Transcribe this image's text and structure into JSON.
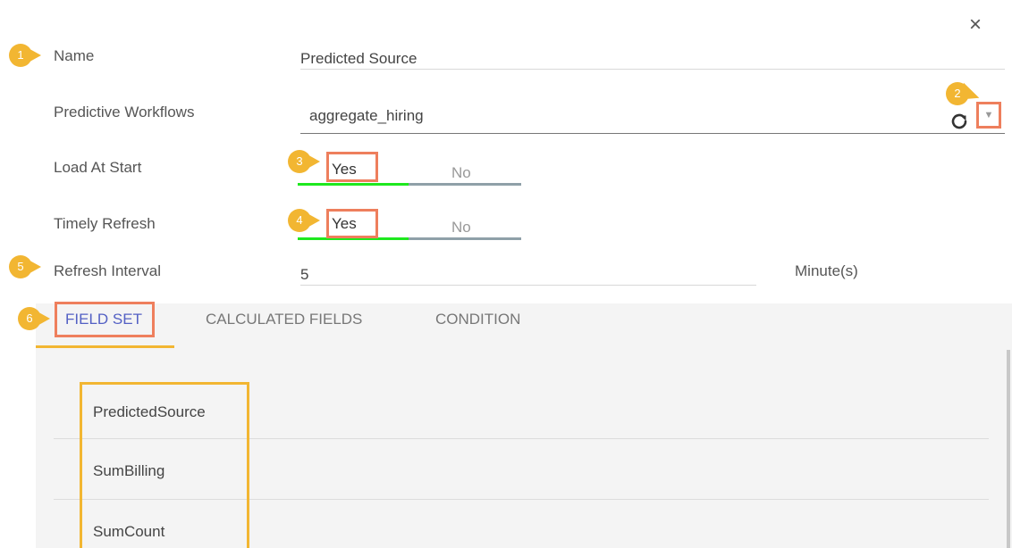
{
  "close_symbol": "×",
  "form": {
    "name": {
      "label": "Name",
      "value": "Predicted Source"
    },
    "workflows": {
      "label": "Predictive Workflows",
      "value": "aggregate_hiring"
    },
    "load_at_start": {
      "label": "Load At Start",
      "yes": "Yes",
      "no": "No",
      "selected": "Yes"
    },
    "timely_refresh": {
      "label": "Timely Refresh",
      "yes": "Yes",
      "no": "No",
      "selected": "Yes"
    },
    "refresh_interval": {
      "label": "Refresh Interval",
      "value": "5",
      "unit": "Minute(s)"
    }
  },
  "markers": [
    "1",
    "2",
    "3",
    "4",
    "5",
    "6"
  ],
  "tabs": [
    {
      "label": "FIELD SET",
      "active": true
    },
    {
      "label": "CALCULATED FIELDS",
      "active": false
    },
    {
      "label": "CONDITION",
      "active": false
    }
  ],
  "fields": [
    "PredictedSource",
    "SumBilling",
    "SumCount"
  ],
  "colors": {
    "marker": "#f2b632",
    "highlight": "#ee7f5d",
    "toggle_on": "#1ee81e",
    "tab_active": "#5360c4"
  },
  "icons": [
    "close-icon",
    "refresh-icon",
    "chevron-down-icon"
  ]
}
